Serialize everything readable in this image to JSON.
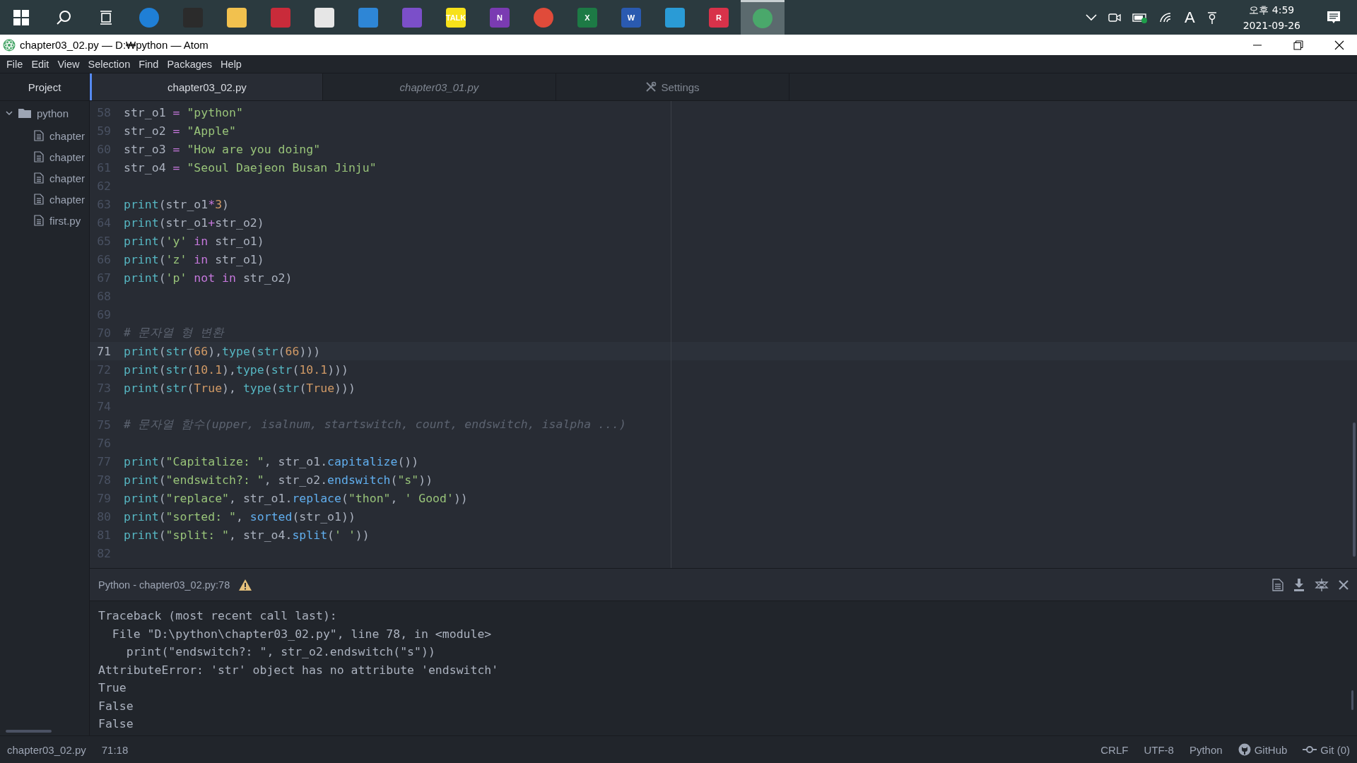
{
  "taskbar": {
    "apps": [
      {
        "kind": "edge",
        "selected": false
      },
      {
        "kind": "store",
        "selected": false
      },
      {
        "kind": "folder",
        "selected": false
      },
      {
        "kind": "redbook",
        "selected": false
      },
      {
        "kind": "sync",
        "selected": false
      },
      {
        "kind": "mail",
        "selected": false
      },
      {
        "kind": "vs",
        "selected": false
      },
      {
        "kind": "talk",
        "label": "TALK",
        "selected": false
      },
      {
        "kind": "onenote",
        "label": "N",
        "selected": false
      },
      {
        "kind": "chrome",
        "selected": false
      },
      {
        "kind": "excel",
        "label": "X",
        "selected": false
      },
      {
        "kind": "word",
        "label": "W",
        "selected": false
      },
      {
        "kind": "bird",
        "selected": false
      },
      {
        "kind": "rapp",
        "label": "R",
        "selected": false
      },
      {
        "kind": "atom",
        "selected": true
      }
    ],
    "ime": "A",
    "time": "오후 4:59",
    "date": "2021-09-26"
  },
  "window": {
    "title": "chapter03_02.py — D:₩python — Atom"
  },
  "menu": [
    "File",
    "Edit",
    "View",
    "Selection",
    "Find",
    "Packages",
    "Help"
  ],
  "sidebar": {
    "title": "Project",
    "tree": [
      {
        "name": "python",
        "kind": "folder",
        "expanded": true,
        "children": [
          {
            "name": "chapter",
            "kind": "file"
          },
          {
            "name": "chapter",
            "kind": "file"
          },
          {
            "name": "chapter",
            "kind": "file"
          },
          {
            "name": "chapter",
            "kind": "file"
          },
          {
            "name": "first.py",
            "kind": "file"
          }
        ]
      }
    ]
  },
  "tabs": [
    {
      "label": "chapter03_02.py",
      "kind": "file",
      "selected": true
    },
    {
      "label": "chapter03_01.py",
      "kind": "file",
      "selected": false
    },
    {
      "label": "Settings",
      "kind": "settings",
      "selected": false
    }
  ],
  "editor": {
    "lines": [
      {
        "num": "58",
        "current": false,
        "tokens": [
          {
            "kind": "plain",
            "t": "str_o1 "
          },
          {
            "kind": "op",
            "t": "="
          },
          {
            "kind": "str",
            "t": " \"python\""
          }
        ]
      },
      {
        "num": "59",
        "current": false,
        "tokens": [
          {
            "kind": "plain",
            "t": "str_o2 "
          },
          {
            "kind": "op",
            "t": "="
          },
          {
            "kind": "str",
            "t": " \"Apple\""
          }
        ]
      },
      {
        "num": "60",
        "current": false,
        "tokens": [
          {
            "kind": "plain",
            "t": "str_o3 "
          },
          {
            "kind": "op",
            "t": "="
          },
          {
            "kind": "str",
            "t": " \"How are you doing\""
          }
        ]
      },
      {
        "num": "61",
        "current": false,
        "tokens": [
          {
            "kind": "plain",
            "t": "str_o4 "
          },
          {
            "kind": "op",
            "t": "="
          },
          {
            "kind": "str",
            "t": " \"Seoul Daejeon Busan Jinju\""
          }
        ]
      },
      {
        "num": "62",
        "current": false
      },
      {
        "num": "63",
        "current": false,
        "tokens": [
          {
            "kind": "fn",
            "t": "print"
          },
          {
            "kind": "plain",
            "t": "(str_o1"
          },
          {
            "kind": "op",
            "t": "*"
          },
          {
            "kind": "num",
            "t": "3"
          },
          {
            "kind": "plain",
            "t": ")"
          }
        ]
      },
      {
        "num": "64",
        "current": false,
        "tokens": [
          {
            "kind": "fn",
            "t": "print"
          },
          {
            "kind": "plain",
            "t": "(str_o1"
          },
          {
            "kind": "op",
            "t": "+"
          },
          {
            "kind": "plain",
            "t": "str_o2)"
          }
        ]
      },
      {
        "num": "65",
        "current": false,
        "tokens": [
          {
            "kind": "fn",
            "t": "print"
          },
          {
            "kind": "plain",
            "t": "("
          },
          {
            "kind": "str",
            "t": "'y'"
          },
          {
            "kind": "kw",
            "t": " in"
          },
          {
            "kind": "plain",
            "t": " str_o1)"
          }
        ]
      },
      {
        "num": "66",
        "current": false,
        "tokens": [
          {
            "kind": "fn",
            "t": "print"
          },
          {
            "kind": "plain",
            "t": "("
          },
          {
            "kind": "str",
            "t": "'z'"
          },
          {
            "kind": "kw",
            "t": " in"
          },
          {
            "kind": "plain",
            "t": " str_o1)"
          }
        ]
      },
      {
        "num": "67",
        "current": false,
        "tokens": [
          {
            "kind": "fn",
            "t": "print"
          },
          {
            "kind": "plain",
            "t": "("
          },
          {
            "kind": "str",
            "t": "'p'"
          },
          {
            "kind": "kw",
            "t": " not in"
          },
          {
            "kind": "plain",
            "t": " str_o2)"
          }
        ]
      },
      {
        "num": "68",
        "current": false
      },
      {
        "num": "69",
        "current": false
      },
      {
        "num": "70",
        "current": false,
        "tokens": [
          {
            "kind": "comment",
            "t": "# 문자열 형 변환"
          }
        ]
      },
      {
        "num": "71",
        "current": true,
        "tokens": [
          {
            "kind": "fn",
            "t": "print"
          },
          {
            "kind": "plain",
            "t": "("
          },
          {
            "kind": "fn",
            "t": "str"
          },
          {
            "kind": "plain",
            "t": "("
          },
          {
            "kind": "num",
            "t": "66"
          },
          {
            "kind": "plain",
            "t": "),"
          },
          {
            "kind": "fn",
            "t": "type"
          },
          {
            "kind": "plain",
            "t": "("
          },
          {
            "kind": "fn",
            "t": "str"
          },
          {
            "kind": "plain",
            "t": "("
          },
          {
            "kind": "num",
            "t": "66"
          },
          {
            "kind": "plain",
            "t": ")))"
          }
        ]
      },
      {
        "num": "72",
        "current": false,
        "tokens": [
          {
            "kind": "fn",
            "t": "print"
          },
          {
            "kind": "plain",
            "t": "("
          },
          {
            "kind": "fn",
            "t": "str"
          },
          {
            "kind": "plain",
            "t": "("
          },
          {
            "kind": "num",
            "t": "10.1"
          },
          {
            "kind": "plain",
            "t": "),"
          },
          {
            "kind": "fn",
            "t": "type"
          },
          {
            "kind": "plain",
            "t": "("
          },
          {
            "kind": "fn",
            "t": "str"
          },
          {
            "kind": "plain",
            "t": "("
          },
          {
            "kind": "num",
            "t": "10.1"
          },
          {
            "kind": "plain",
            "t": ")))"
          }
        ]
      },
      {
        "num": "73",
        "current": false,
        "tokens": [
          {
            "kind": "fn",
            "t": "print"
          },
          {
            "kind": "plain",
            "t": "("
          },
          {
            "kind": "fn",
            "t": "str"
          },
          {
            "kind": "plain",
            "t": "("
          },
          {
            "kind": "num",
            "t": "True"
          },
          {
            "kind": "plain",
            "t": "),"
          },
          {
            "kind": "fn",
            "t": " type"
          },
          {
            "kind": "plain",
            "t": "("
          },
          {
            "kind": "fn",
            "t": "str"
          },
          {
            "kind": "plain",
            "t": "("
          },
          {
            "kind": "num",
            "t": "True"
          },
          {
            "kind": "plain",
            "t": ")))"
          }
        ]
      },
      {
        "num": "74",
        "current": false
      },
      {
        "num": "75",
        "current": false,
        "tokens": [
          {
            "kind": "comment",
            "t": "# 문자열 함수(upper, isalnum, startswitch, count, endswitch, isalpha ...)"
          }
        ]
      },
      {
        "num": "76",
        "current": false
      },
      {
        "num": "77",
        "current": false,
        "tokens": [
          {
            "kind": "fn",
            "t": "print"
          },
          {
            "kind": "plain",
            "t": "("
          },
          {
            "kind": "str",
            "t": "\"Capitalize: \""
          },
          {
            "kind": "plain",
            "t": ", str_o1."
          },
          {
            "kind": "method",
            "t": "capitalize"
          },
          {
            "kind": "plain",
            "t": "())"
          }
        ]
      },
      {
        "num": "78",
        "current": false,
        "tokens": [
          {
            "kind": "fn",
            "t": "print"
          },
          {
            "kind": "plain",
            "t": "("
          },
          {
            "kind": "str",
            "t": "\"endswitch?: \""
          },
          {
            "kind": "plain",
            "t": ", str_o2."
          },
          {
            "kind": "method",
            "t": "endswitch"
          },
          {
            "kind": "plain",
            "t": "("
          },
          {
            "kind": "str",
            "t": "\"s\""
          },
          {
            "kind": "plain",
            "t": "))"
          }
        ]
      },
      {
        "num": "79",
        "current": false,
        "tokens": [
          {
            "kind": "fn",
            "t": "print"
          },
          {
            "kind": "plain",
            "t": "("
          },
          {
            "kind": "str",
            "t": "\"replace\""
          },
          {
            "kind": "plain",
            "t": ", str_o1."
          },
          {
            "kind": "method",
            "t": "replace"
          },
          {
            "kind": "plain",
            "t": "("
          },
          {
            "kind": "str",
            "t": "\"thon\""
          },
          {
            "kind": "plain",
            "t": ","
          },
          {
            "kind": "str",
            "t": " ' Good'"
          },
          {
            "kind": "plain",
            "t": "))"
          }
        ]
      },
      {
        "num": "80",
        "current": false,
        "tokens": [
          {
            "kind": "fn",
            "t": "print"
          },
          {
            "kind": "plain",
            "t": "("
          },
          {
            "kind": "str",
            "t": "\"sorted: \""
          },
          {
            "kind": "plain",
            "t": ","
          },
          {
            "kind": "method",
            "t": " sorted"
          },
          {
            "kind": "plain",
            "t": "(str_o1))"
          }
        ]
      },
      {
        "num": "81",
        "current": false,
        "tokens": [
          {
            "kind": "fn",
            "t": "print"
          },
          {
            "kind": "plain",
            "t": "("
          },
          {
            "kind": "str",
            "t": "\"split: \""
          },
          {
            "kind": "plain",
            "t": ", str_o4."
          },
          {
            "kind": "method",
            "t": "split"
          },
          {
            "kind": "plain",
            "t": "("
          },
          {
            "kind": "str",
            "t": "' '"
          },
          {
            "kind": "plain",
            "t": "))"
          }
        ]
      },
      {
        "num": "82",
        "current": false
      }
    ]
  },
  "output": {
    "title": "Python - chapter03_02.py:78",
    "warning": true,
    "lines": [
      "Traceback (most recent call last):",
      "  File \"D:\\python\\chapter03_02.py\", line 78, in <module>",
      "    print(\"endswitch?: \", str_o2.endswitch(\"s\"))",
      "AttributeError: 'str' object has no attribute 'endswitch'",
      "True",
      "False",
      "False"
    ]
  },
  "status_bar": {
    "file": "chapter03_02.py",
    "cursor": "71:18",
    "items": [
      {
        "kind": "text",
        "label": "CRLF"
      },
      {
        "kind": "text",
        "label": "UTF-8"
      },
      {
        "kind": "text",
        "label": "Python"
      },
      {
        "kind": "github",
        "label": "GitHub"
      },
      {
        "kind": "git",
        "label": "Git (0)"
      }
    ]
  }
}
